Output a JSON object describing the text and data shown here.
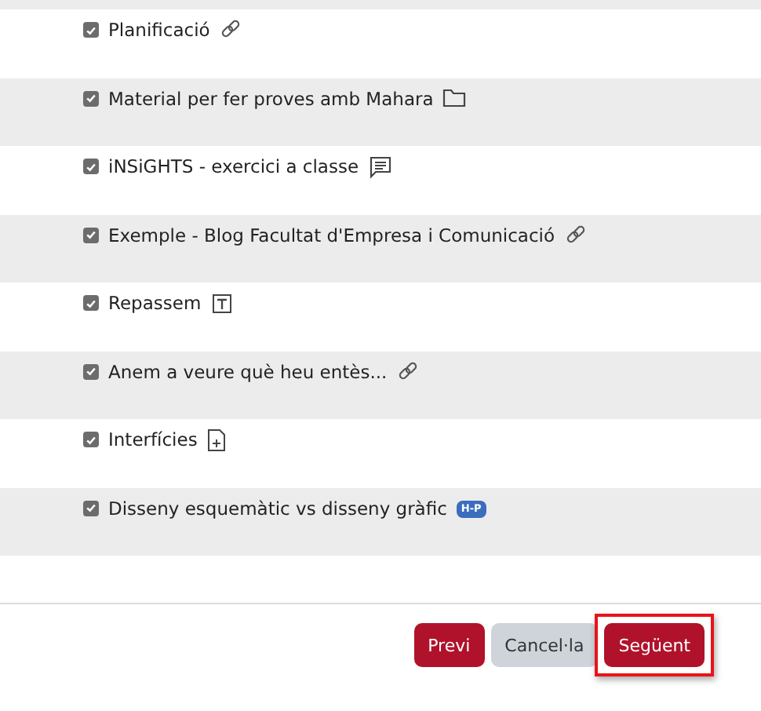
{
  "activities": [
    {
      "label": "Planificació",
      "checked": true,
      "kind": "link"
    },
    {
      "label": "Material per fer proves amb Mahara",
      "checked": true,
      "kind": "folder"
    },
    {
      "label": "iNSiGHTS - exercici a classe",
      "checked": true,
      "kind": "forum"
    },
    {
      "label": "Exemple - Blog Facultat d'Empresa i Comunicació",
      "checked": true,
      "kind": "link"
    },
    {
      "label": "Repassem",
      "checked": true,
      "kind": "text"
    },
    {
      "label": "Anem a veure què heu entès...",
      "checked": true,
      "kind": "link"
    },
    {
      "label": "Interfícies",
      "checked": true,
      "kind": "page"
    },
    {
      "label": "Disseny esquemàtic vs disseny gràfic",
      "checked": true,
      "kind": "h5p",
      "badge": "H-P"
    }
  ],
  "buttons": [
    {
      "label": "Previ",
      "kind": "primary",
      "focused": false
    },
    {
      "label": "Cancel·la",
      "kind": "secondary",
      "focused": false
    },
    {
      "label": "Següent",
      "kind": "primary",
      "focused": true
    }
  ]
}
